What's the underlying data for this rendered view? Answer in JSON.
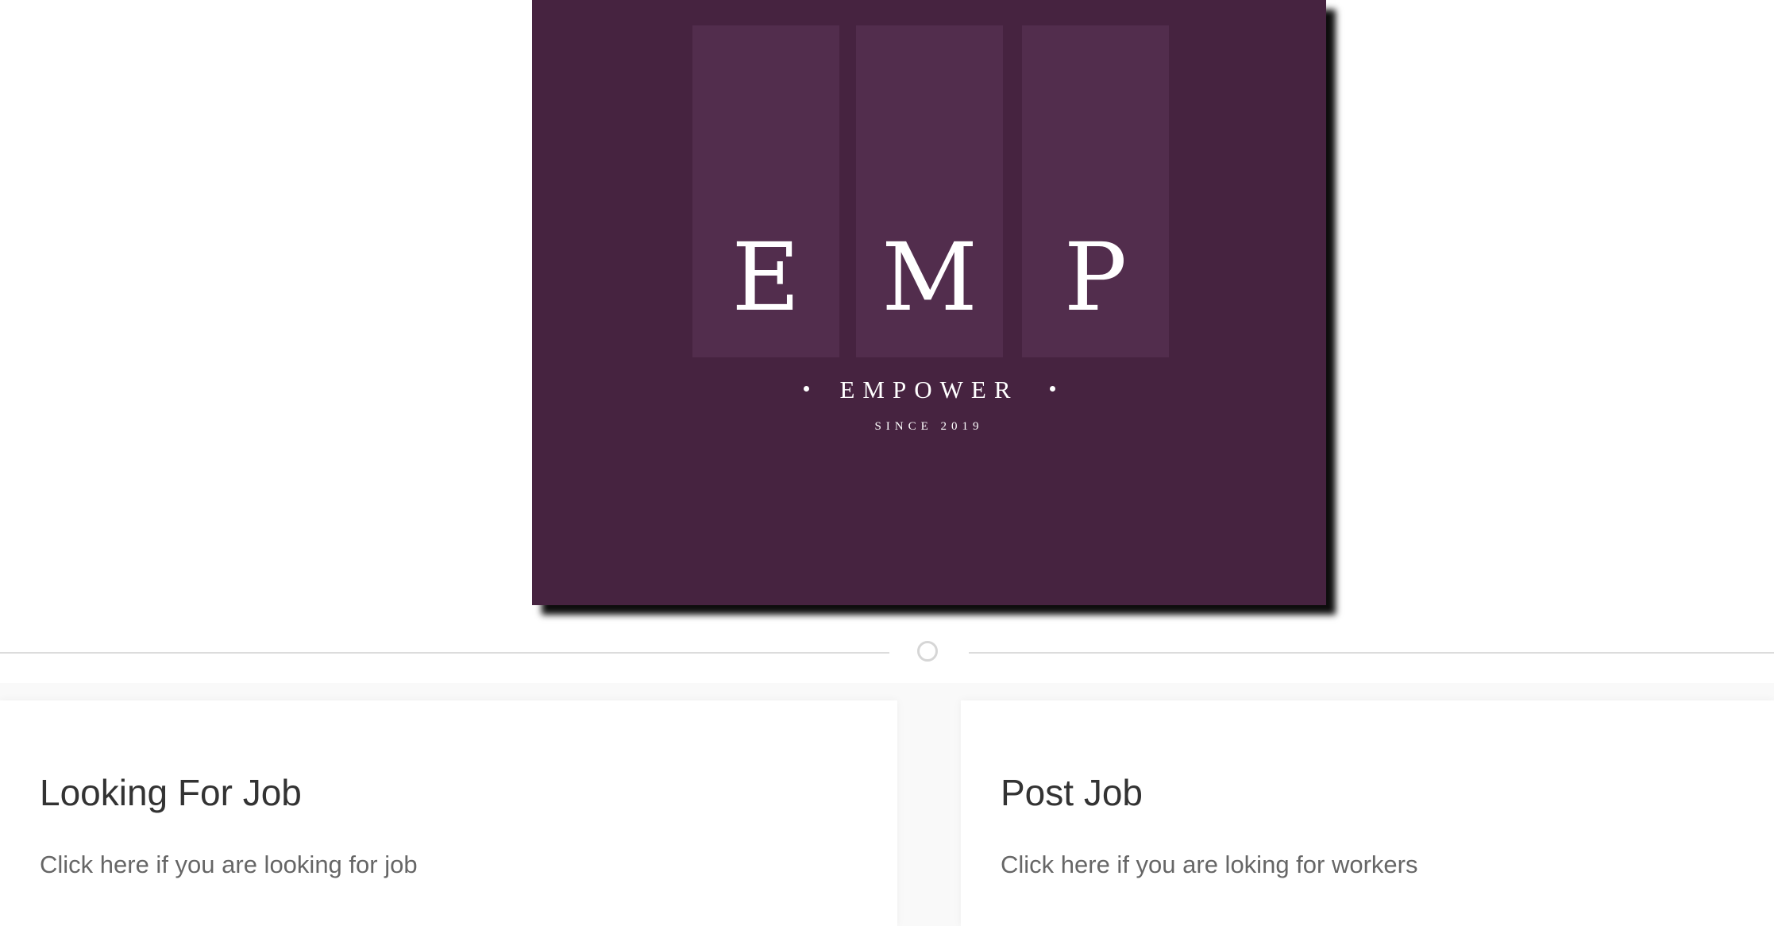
{
  "colors": {
    "logo_background": "#462340",
    "logo_bar": "#522d4d",
    "logo_text": "#ffffff"
  },
  "logo": {
    "letters": [
      "E",
      "M",
      "P"
    ],
    "name": "EMPOWER",
    "since": "SINCE 2019"
  },
  "divider": {
    "icon": "circle-icon"
  },
  "cards": [
    {
      "title": "Looking For Job",
      "description": "Click here if you are looking for job"
    },
    {
      "title": "Post Job",
      "description": "Click here if you are loking for workers"
    }
  ]
}
